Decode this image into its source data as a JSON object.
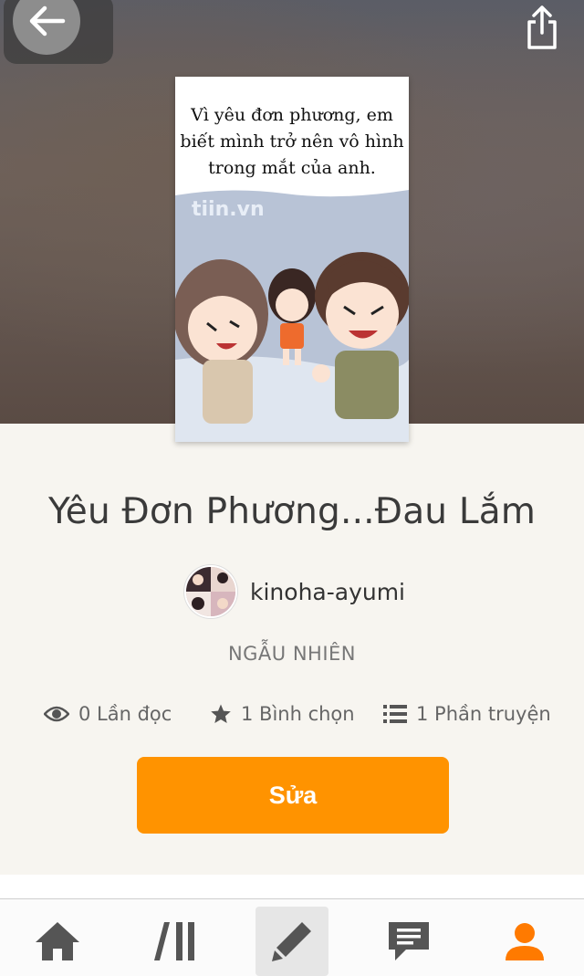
{
  "story": {
    "title": "Yêu Đơn Phương...Đau Lắm",
    "cover_text": "Vì yêu đơn phương, em biết mình trở nên vô hình trong mắt của anh.",
    "cover_watermark": "tiin.vn",
    "author": "kinoha-ayumi",
    "category": "NGẪU NHIÊN"
  },
  "stats": {
    "reads": "0 Lần đọc",
    "votes": "1 Bình chọn",
    "parts": "1 Phần truyện"
  },
  "actions": {
    "edit_label": "Sửa"
  },
  "icons": {
    "back": "back-arrow-icon",
    "share": "share-icon",
    "reads": "eye-icon",
    "votes": "star-icon",
    "parts": "list-icon"
  },
  "tabbar": {
    "items": [
      {
        "name": "home",
        "icon": "home-icon",
        "active": false
      },
      {
        "name": "library",
        "icon": "library-icon",
        "active": false
      },
      {
        "name": "write",
        "icon": "pencil-icon",
        "active": true
      },
      {
        "name": "messages",
        "icon": "chat-icon",
        "active": false
      },
      {
        "name": "profile",
        "icon": "profile-icon",
        "active": false
      }
    ]
  },
  "colors": {
    "accent": "#ff9300",
    "text": "#3a3a3a",
    "icon_gray": "#555555",
    "background": "#f7f5f0"
  }
}
